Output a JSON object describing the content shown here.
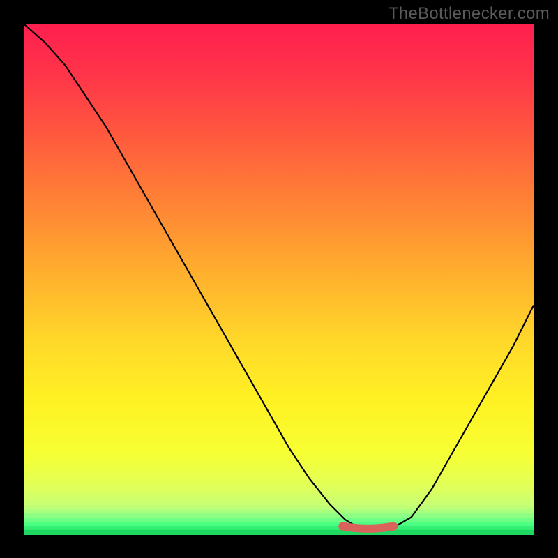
{
  "watermark": "TheBottlenecker.com",
  "chart_data": {
    "type": "line",
    "title": "",
    "xlabel": "",
    "ylabel": "",
    "xlim": [
      0,
      100
    ],
    "ylim": [
      0,
      100
    ],
    "x": [
      0,
      4,
      8,
      12,
      16,
      20,
      24,
      28,
      32,
      36,
      40,
      44,
      48,
      52,
      56,
      60,
      63,
      66,
      69,
      72,
      76,
      80,
      84,
      88,
      92,
      96,
      100
    ],
    "y": [
      100,
      96.5,
      92,
      86,
      80,
      73,
      66,
      59,
      52,
      45,
      38,
      31,
      24,
      17,
      11,
      6,
      3,
      1.2,
      1.0,
      1.2,
      3.5,
      9,
      16,
      23,
      30,
      37,
      45
    ],
    "highlight_range_x": [
      62.5,
      72.5
    ],
    "highlight_y": 1.1,
    "gradient_stops": [
      {
        "offset": 0.0,
        "color": "#ff1f4f"
      },
      {
        "offset": 0.1,
        "color": "#ff3549"
      },
      {
        "offset": 0.22,
        "color": "#ff5a3e"
      },
      {
        "offset": 0.35,
        "color": "#ff8335"
      },
      {
        "offset": 0.48,
        "color": "#ffad2e"
      },
      {
        "offset": 0.62,
        "color": "#ffd82a"
      },
      {
        "offset": 0.74,
        "color": "#fff223"
      },
      {
        "offset": 0.84,
        "color": "#f6ff33"
      },
      {
        "offset": 0.9,
        "color": "#e3ff55"
      },
      {
        "offset": 0.945,
        "color": "#c5ff76"
      },
      {
        "offset": 0.972,
        "color": "#8dff8a"
      },
      {
        "offset": 0.988,
        "color": "#4bff82"
      },
      {
        "offset": 1.0,
        "color": "#1dde5e"
      }
    ],
    "green_bands": [
      {
        "y0": 0.942,
        "y1": 0.95,
        "color": "#bfff78"
      },
      {
        "y0": 0.95,
        "y1": 0.958,
        "color": "#a9ff7e"
      },
      {
        "y0": 0.958,
        "y1": 0.966,
        "color": "#8cff84"
      },
      {
        "y0": 0.966,
        "y1": 0.974,
        "color": "#6cff85"
      },
      {
        "y0": 0.974,
        "y1": 0.982,
        "color": "#4dff82"
      },
      {
        "y0": 0.982,
        "y1": 0.99,
        "color": "#33ef74"
      },
      {
        "y0": 0.99,
        "y1": 1.0,
        "color": "#1fd861"
      }
    ],
    "curve_color": "#000000",
    "highlight_color": "#d9635a"
  }
}
